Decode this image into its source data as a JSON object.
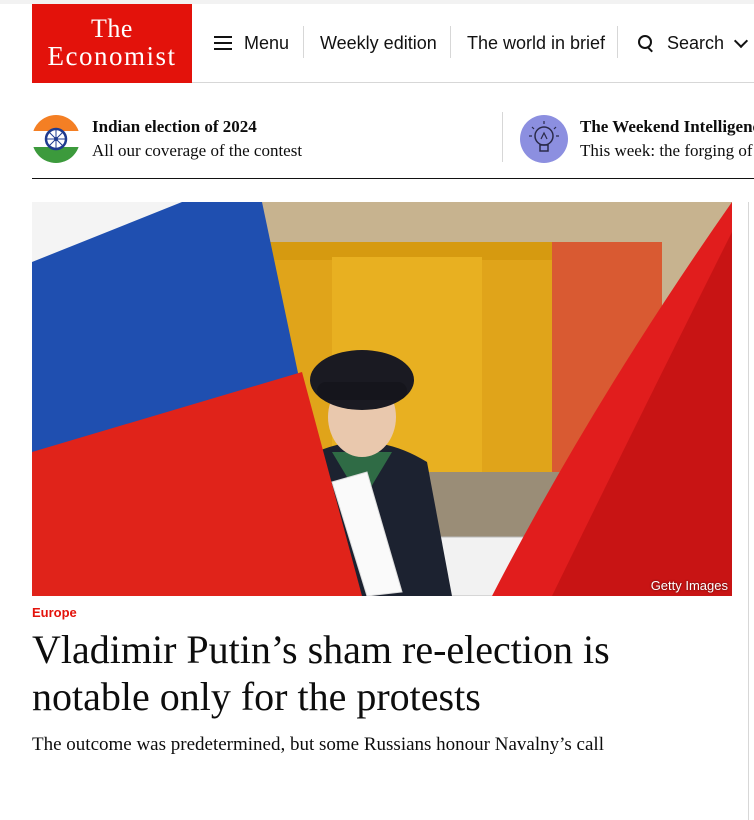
{
  "brand": {
    "line1": "The",
    "line2": "Economist",
    "color": "#e3120b"
  },
  "nav": {
    "menu_label": "Menu",
    "weekly_label": "Weekly edition",
    "world_label": "The world in brief",
    "search_label": "Search"
  },
  "promos": [
    {
      "title": "Indian election of 2024",
      "subtitle": "All our coverage of the contest",
      "icon": "india-flag-icon"
    },
    {
      "title": "The Weekend Intelligence",
      "subtitle": "This week: the forging of",
      "icon": "lightbulb-icon"
    }
  ],
  "article": {
    "image_credit": "Getty Images",
    "section": "Europe",
    "headline": "Vladimir Putin’s sham re-election is notable only for the protests",
    "standfirst": "The outcome was predetermined, but some Russians honour Navalny’s call"
  }
}
